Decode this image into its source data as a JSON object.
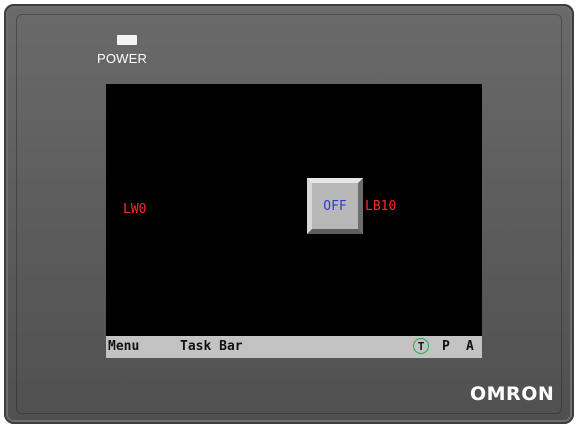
{
  "device": {
    "power_label": "POWER",
    "brand": "OMRON",
    "bezel_color": "#5e5e5e"
  },
  "screen": {
    "background": "#000000",
    "lamp_label": "LW0",
    "switch_label": "LB10",
    "toggle_button": {
      "label": "OFF",
      "state": "off",
      "label_color": "#2f3cc8"
    },
    "label_color": "#ff2a2a"
  },
  "taskbar": {
    "menu_label": "Menu",
    "title": "Task Bar",
    "indicators": {
      "t": "T",
      "p": "P",
      "a": "A"
    },
    "t_ring_color": "#1ea84a"
  }
}
